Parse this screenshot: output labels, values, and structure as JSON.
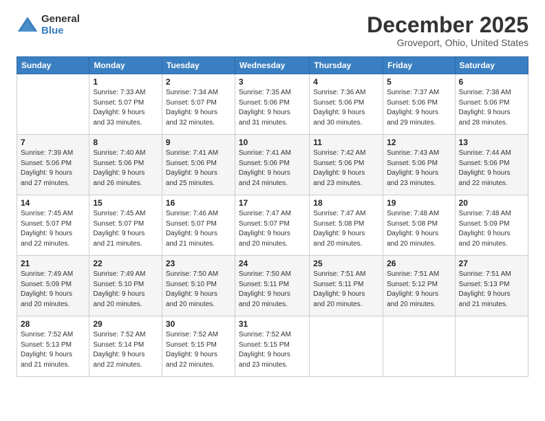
{
  "logo": {
    "general": "General",
    "blue": "Blue"
  },
  "title": "December 2025",
  "subtitle": "Groveport, Ohio, United States",
  "days_of_week": [
    "Sunday",
    "Monday",
    "Tuesday",
    "Wednesday",
    "Thursday",
    "Friday",
    "Saturday"
  ],
  "weeks": [
    [
      {
        "day": "",
        "info": ""
      },
      {
        "day": "1",
        "info": "Sunrise: 7:33 AM\nSunset: 5:07 PM\nDaylight: 9 hours\nand 33 minutes."
      },
      {
        "day": "2",
        "info": "Sunrise: 7:34 AM\nSunset: 5:07 PM\nDaylight: 9 hours\nand 32 minutes."
      },
      {
        "day": "3",
        "info": "Sunrise: 7:35 AM\nSunset: 5:06 PM\nDaylight: 9 hours\nand 31 minutes."
      },
      {
        "day": "4",
        "info": "Sunrise: 7:36 AM\nSunset: 5:06 PM\nDaylight: 9 hours\nand 30 minutes."
      },
      {
        "day": "5",
        "info": "Sunrise: 7:37 AM\nSunset: 5:06 PM\nDaylight: 9 hours\nand 29 minutes."
      },
      {
        "day": "6",
        "info": "Sunrise: 7:38 AM\nSunset: 5:06 PM\nDaylight: 9 hours\nand 28 minutes."
      }
    ],
    [
      {
        "day": "7",
        "info": "Sunrise: 7:39 AM\nSunset: 5:06 PM\nDaylight: 9 hours\nand 27 minutes."
      },
      {
        "day": "8",
        "info": "Sunrise: 7:40 AM\nSunset: 5:06 PM\nDaylight: 9 hours\nand 26 minutes."
      },
      {
        "day": "9",
        "info": "Sunrise: 7:41 AM\nSunset: 5:06 PM\nDaylight: 9 hours\nand 25 minutes."
      },
      {
        "day": "10",
        "info": "Sunrise: 7:41 AM\nSunset: 5:06 PM\nDaylight: 9 hours\nand 24 minutes."
      },
      {
        "day": "11",
        "info": "Sunrise: 7:42 AM\nSunset: 5:06 PM\nDaylight: 9 hours\nand 23 minutes."
      },
      {
        "day": "12",
        "info": "Sunrise: 7:43 AM\nSunset: 5:06 PM\nDaylight: 9 hours\nand 23 minutes."
      },
      {
        "day": "13",
        "info": "Sunrise: 7:44 AM\nSunset: 5:06 PM\nDaylight: 9 hours\nand 22 minutes."
      }
    ],
    [
      {
        "day": "14",
        "info": "Sunrise: 7:45 AM\nSunset: 5:07 PM\nDaylight: 9 hours\nand 22 minutes."
      },
      {
        "day": "15",
        "info": "Sunrise: 7:45 AM\nSunset: 5:07 PM\nDaylight: 9 hours\nand 21 minutes."
      },
      {
        "day": "16",
        "info": "Sunrise: 7:46 AM\nSunset: 5:07 PM\nDaylight: 9 hours\nand 21 minutes."
      },
      {
        "day": "17",
        "info": "Sunrise: 7:47 AM\nSunset: 5:07 PM\nDaylight: 9 hours\nand 20 minutes."
      },
      {
        "day": "18",
        "info": "Sunrise: 7:47 AM\nSunset: 5:08 PM\nDaylight: 9 hours\nand 20 minutes."
      },
      {
        "day": "19",
        "info": "Sunrise: 7:48 AM\nSunset: 5:08 PM\nDaylight: 9 hours\nand 20 minutes."
      },
      {
        "day": "20",
        "info": "Sunrise: 7:48 AM\nSunset: 5:09 PM\nDaylight: 9 hours\nand 20 minutes."
      }
    ],
    [
      {
        "day": "21",
        "info": "Sunrise: 7:49 AM\nSunset: 5:09 PM\nDaylight: 9 hours\nand 20 minutes."
      },
      {
        "day": "22",
        "info": "Sunrise: 7:49 AM\nSunset: 5:10 PM\nDaylight: 9 hours\nand 20 minutes."
      },
      {
        "day": "23",
        "info": "Sunrise: 7:50 AM\nSunset: 5:10 PM\nDaylight: 9 hours\nand 20 minutes."
      },
      {
        "day": "24",
        "info": "Sunrise: 7:50 AM\nSunset: 5:11 PM\nDaylight: 9 hours\nand 20 minutes."
      },
      {
        "day": "25",
        "info": "Sunrise: 7:51 AM\nSunset: 5:11 PM\nDaylight: 9 hours\nand 20 minutes."
      },
      {
        "day": "26",
        "info": "Sunrise: 7:51 AM\nSunset: 5:12 PM\nDaylight: 9 hours\nand 20 minutes."
      },
      {
        "day": "27",
        "info": "Sunrise: 7:51 AM\nSunset: 5:13 PM\nDaylight: 9 hours\nand 21 minutes."
      }
    ],
    [
      {
        "day": "28",
        "info": "Sunrise: 7:52 AM\nSunset: 5:13 PM\nDaylight: 9 hours\nand 21 minutes."
      },
      {
        "day": "29",
        "info": "Sunrise: 7:52 AM\nSunset: 5:14 PM\nDaylight: 9 hours\nand 22 minutes."
      },
      {
        "day": "30",
        "info": "Sunrise: 7:52 AM\nSunset: 5:15 PM\nDaylight: 9 hours\nand 22 minutes."
      },
      {
        "day": "31",
        "info": "Sunrise: 7:52 AM\nSunset: 5:15 PM\nDaylight: 9 hours\nand 23 minutes."
      },
      {
        "day": "",
        "info": ""
      },
      {
        "day": "",
        "info": ""
      },
      {
        "day": "",
        "info": ""
      }
    ]
  ]
}
